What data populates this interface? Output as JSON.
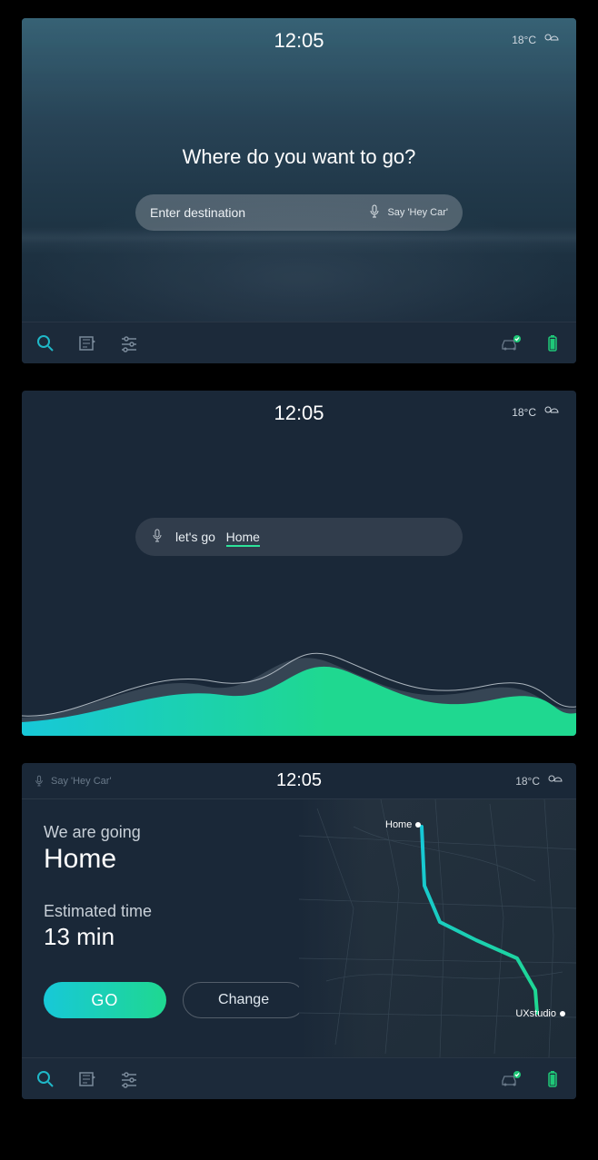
{
  "status": {
    "time": "12:05",
    "temperature": "18°C",
    "weather_icon": "partly-cloudy"
  },
  "screen1": {
    "prompt": "Where do you want to go?",
    "search_placeholder": "Enter destination",
    "voice_hint": "Say 'Hey Car'"
  },
  "screen2": {
    "voice_prefix": "let's go",
    "voice_keyword": "Home"
  },
  "screen3": {
    "top_voice_hint": "Say 'Hey Car'",
    "going_label": "We are going",
    "destination": "Home",
    "eta_label": "Estimated time",
    "eta_value": "13 min",
    "go_button": "GO",
    "change_button": "Change",
    "map_origin_label": "Home",
    "map_dest_label": "UXstudio"
  },
  "bottombar_icons": [
    "search",
    "media",
    "settings",
    "car-status",
    "battery"
  ]
}
